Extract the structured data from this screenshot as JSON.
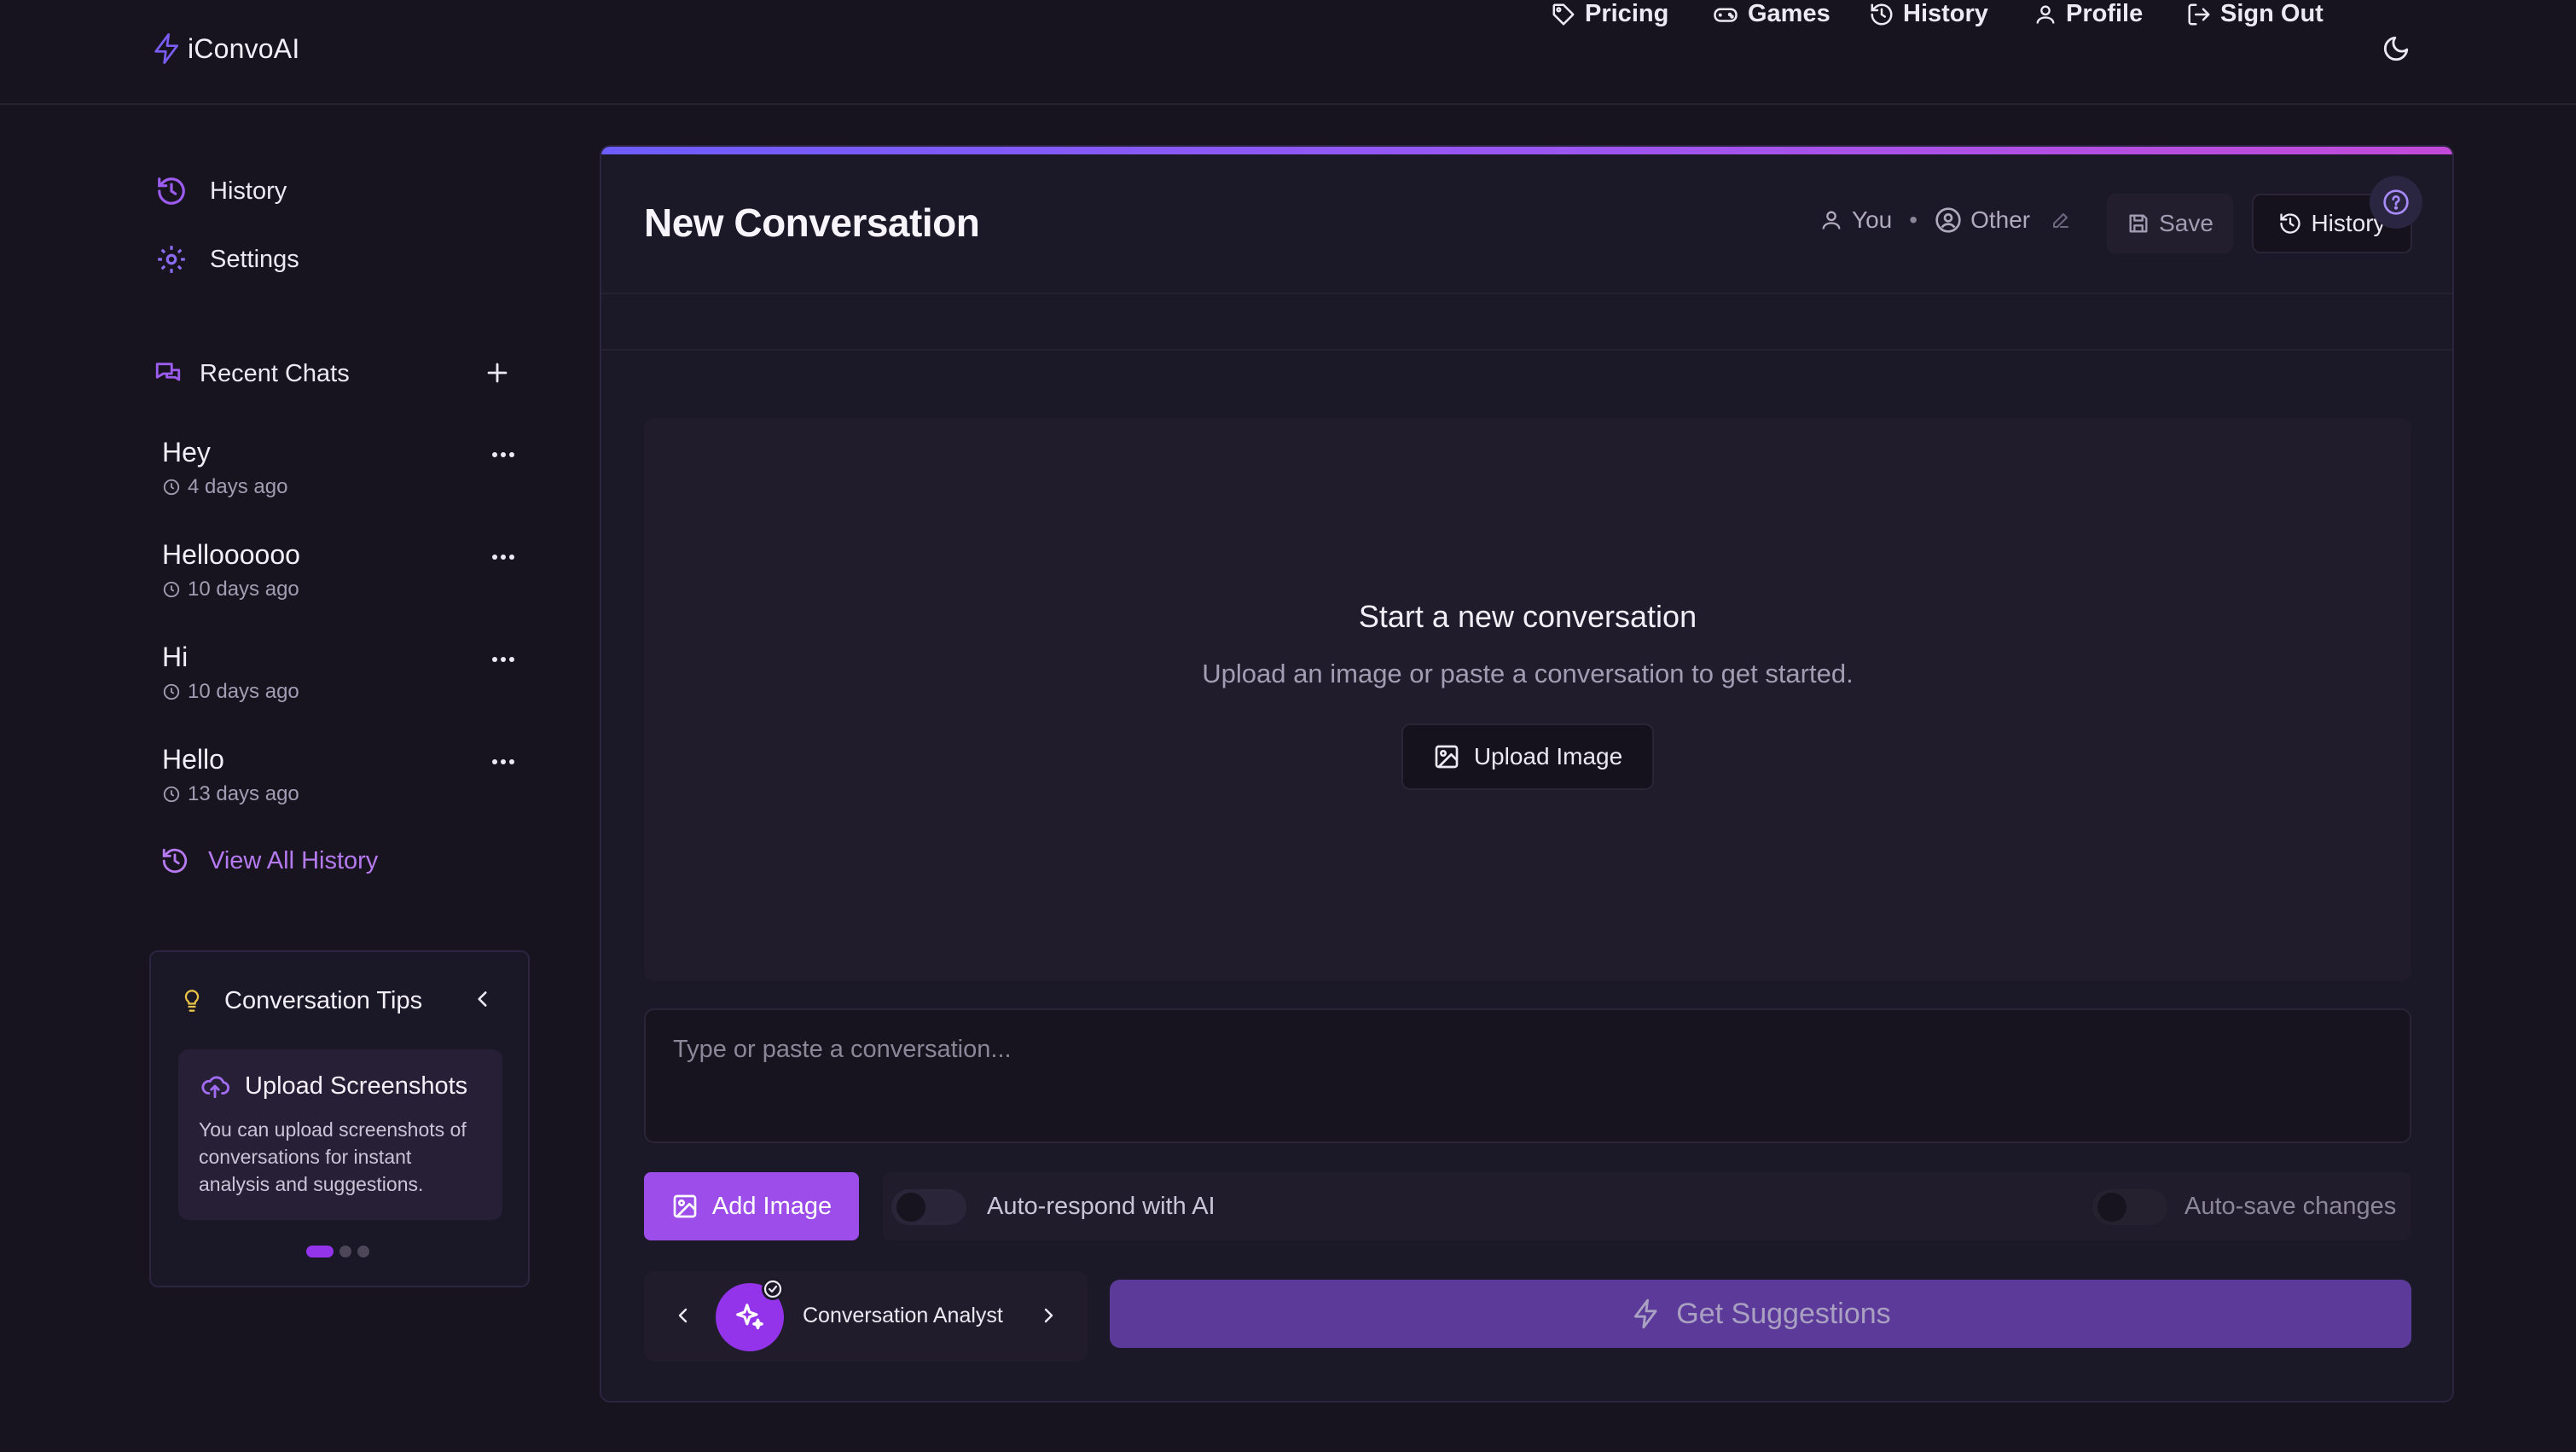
{
  "brand": {
    "name": "iConvoAI",
    "icon": "bolt-icon"
  },
  "nav": {
    "items": [
      {
        "label": "Pricing",
        "icon": "tag-icon"
      },
      {
        "label": "Games",
        "icon": "gamepad-icon"
      },
      {
        "label": "History",
        "icon": "history-icon"
      },
      {
        "label": "Profile",
        "icon": "user-icon"
      },
      {
        "label": "Sign Out",
        "icon": "sign-out-icon"
      }
    ],
    "theme_icon": "moon-icon"
  },
  "sidebar": {
    "links": [
      {
        "label": "History",
        "icon": "history-icon"
      },
      {
        "label": "Settings",
        "icon": "gear-icon"
      }
    ],
    "recent": {
      "title": "Recent Chats",
      "chats": [
        {
          "name": "Hey",
          "time": "4 days ago"
        },
        {
          "name": "Helloooooo",
          "time": "10 days ago"
        },
        {
          "name": "Hi",
          "time": "10 days ago"
        },
        {
          "name": "Hello",
          "time": "13 days ago"
        }
      ],
      "view_all": "View All History"
    },
    "tips": {
      "title": "Conversation Tips",
      "card": {
        "title": "Upload Screenshots",
        "desc": "You can upload screenshots of conversations for instant analysis and suggestions."
      },
      "pages": 3,
      "active_page": 1
    }
  },
  "main": {
    "title": "New Conversation",
    "participants": {
      "you": "You",
      "other": "Other",
      "separator": "•"
    },
    "save_label": "Save",
    "history_label": "History",
    "empty": {
      "title": "Start a new conversation",
      "subtitle": "Upload an image or paste a conversation to get started.",
      "upload_label": "Upload Image"
    },
    "compose_placeholder": "Type or paste a conversation...",
    "add_image_label": "Add Image",
    "auto_respond": {
      "label": "Auto-respond with AI",
      "on": false
    },
    "auto_save": {
      "label": "Auto-save changes",
      "on": false
    },
    "agent": {
      "name": "Conversation Analyst"
    },
    "suggest_label": "Get Suggestions"
  },
  "colors": {
    "background": "#17141f",
    "accent": "#9d4eea",
    "accent_link": "#b57af0",
    "tip_icon": "#e8c347",
    "suggest_button": "#5b3a9a"
  }
}
